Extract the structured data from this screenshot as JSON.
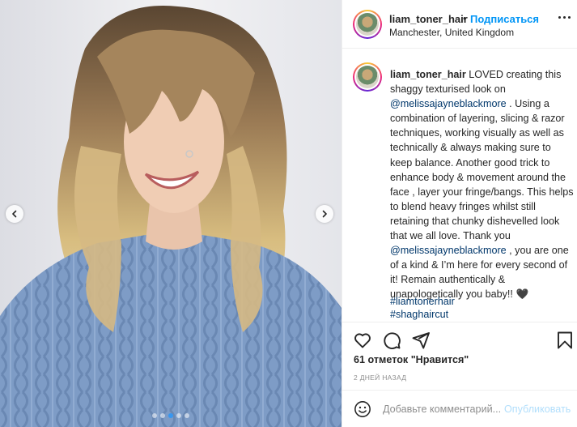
{
  "post": {
    "username": "liam_toner_hair",
    "separator": "•",
    "follow_label": "Подписаться",
    "location": "Manchester, United Kingdom",
    "more_icon": "more-horizontal-icon"
  },
  "caption": {
    "username": "liam_toner_hair",
    "text_1": " LOVED creating this shaggy texturised look on ",
    "mention_1": "@melissajayneblackmore",
    "text_2": " . Using a combination of layering, slicing & razor techniques, working visually as well as technically & always making sure to keep balance. Another good trick to enhance body & movement around the face , layer your fringe/bangs. This helps to blend heavy fringes whilst still retaining that chunky dishevelled look that we all love. Thank you ",
    "mention_2": "@melissajayneblackmore",
    "text_3": " , you are one of a kind & I’m here for every second of it! Remain authentically & unapologetically you baby!! ",
    "heart_emoji": "🖤",
    "hashtags": [
      "#liamtonerhair",
      "#shaghaircut"
    ]
  },
  "actions": {
    "like_icon": "heart-icon",
    "comment_icon": "comment-icon",
    "share_icon": "share-icon",
    "save_icon": "bookmark-icon"
  },
  "likes_label": "61 отметок \"Нравится\"",
  "timestamp": "2 ДНЕЙ НАЗАД",
  "comment": {
    "emoji_icon": "smiley-icon",
    "placeholder": "Добавьте комментарий...",
    "post_label": "Опубликовать"
  },
  "carousel": {
    "prev_icon": "chevron-left-icon",
    "next_icon": "chevron-right-icon",
    "slide_count": 5,
    "active_slide": 3
  },
  "colors": {
    "accent_blue": "#0095f6",
    "link_dark": "#00376b",
    "muted": "#8e8e8e",
    "post_disabled": "#b2dffc"
  }
}
